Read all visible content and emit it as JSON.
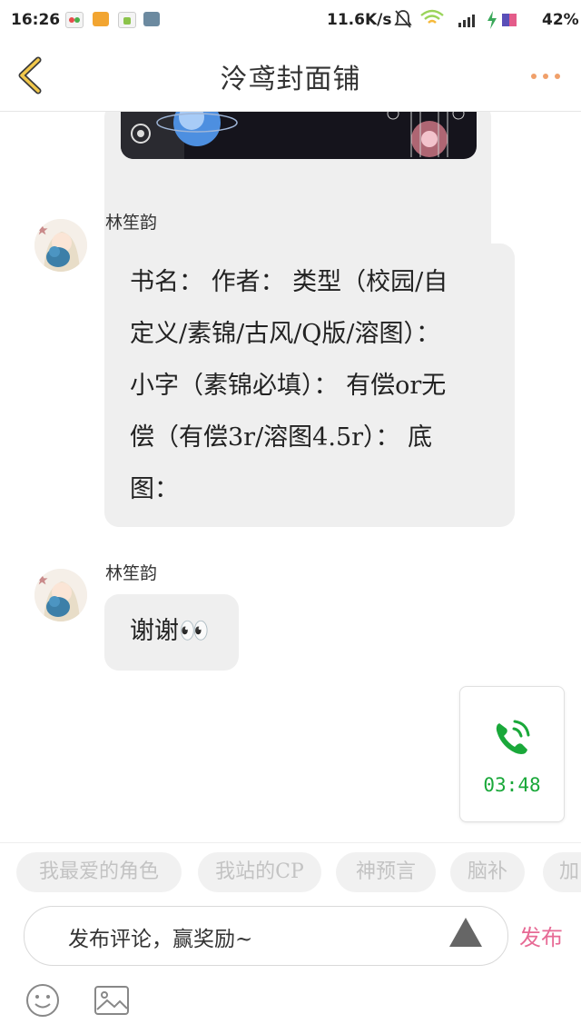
{
  "status_bar": {
    "time": "16:26",
    "net_speed": "11.6K/s",
    "battery": "42%"
  },
  "header": {
    "title": "泠鸢封面铺",
    "back_icon": "chevron-left-icon",
    "more_icon": "more-dots-icon",
    "accent_color": "#e8a23a"
  },
  "messages": [
    {
      "sender": "林笙韵",
      "text_lines": [
        "书名： 作者： 类型（校园/自",
        "定义/素锦/古风/Q版/溶图）：",
        "小字（素锦必填）： 有偿or无",
        "偿（有偿3r/溶图4.5r）： 底",
        "图："
      ]
    },
    {
      "sender": "林笙韵",
      "text": "谢谢👀"
    }
  ],
  "call_card": {
    "icon": "phone-call-icon",
    "duration": "03:48",
    "color": "#1aa83a"
  },
  "tags": [
    "我最爱的角色",
    "我站的CP",
    "神预言",
    "脑补",
    "加"
  ],
  "composer": {
    "placeholder": "发布评论，赢奖励~",
    "send_label": "发布",
    "send_color": "#e76a95"
  },
  "tools": [
    "emoji-icon",
    "image-icon"
  ]
}
